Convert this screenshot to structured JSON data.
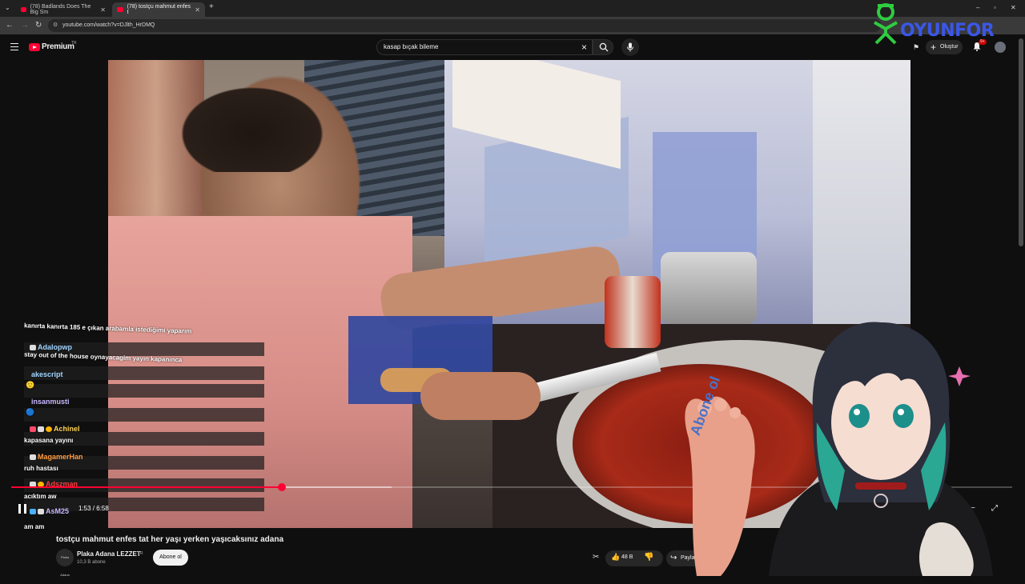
{
  "browser": {
    "tabs": [
      {
        "label": "(78) Badlands Does The Big Sm",
        "active": false
      },
      {
        "label": "(78) tostçu mahmut enfes t",
        "active": true
      }
    ],
    "url": "youtube.com/watch?v=DJlth_HrDMQ"
  },
  "header": {
    "logo": "Premium",
    "country": "TR",
    "search_value": "kasap bıçak bileme",
    "create_label": "Oluştur",
    "notif_badge": "9+"
  },
  "overlay_logo": {
    "text": "OYUNFOR"
  },
  "player": {
    "time": "1:53 / 6:58",
    "progress": 0.27,
    "buffered": 0.38
  },
  "chat": [
    {
      "user": "",
      "message": "kanırta kanırta 185 e çıkan arabamla istediğimi yaparım"
    },
    {
      "user": "Adalopwp",
      "message": "stay out of the house oynayacagim yayın kapanınca",
      "color": "#9fd4ff"
    },
    {
      "user": "akescript",
      "message": "",
      "color": "#9fd4ff"
    },
    {
      "user": "insanmusti",
      "message": "",
      "color": "#c8b8ff"
    },
    {
      "user": "Achinel",
      "message": "kapasana yayını",
      "color": "#ffd257"
    },
    {
      "user": "MagamerHan",
      "message": "ruh hastası",
      "color": "#ff9a3c"
    },
    {
      "user": "Adszman",
      "message": "acıktım aw",
      "color": "#ff3b3b"
    },
    {
      "user": "AsM25",
      "message": "am am",
      "color": "#c8b8ff"
    }
  ],
  "video": {
    "title": "tostçu mahmut enfes tat her yaşı yerken yaşıcaksınız adana",
    "channel": "Plaka Adana LEZZET",
    "channel_flag": "TR",
    "channel_avatar_text": "Plaka Adana",
    "subscribers": "10,3 B abone",
    "subscribe_label": "Abone ol",
    "likes": "48 B",
    "share_label": "Paylaş"
  },
  "vtuber_overlay": {
    "sign_text": "Abone ol"
  },
  "colors": {
    "accent": "#ff0033",
    "background": "#0f0f0f"
  }
}
